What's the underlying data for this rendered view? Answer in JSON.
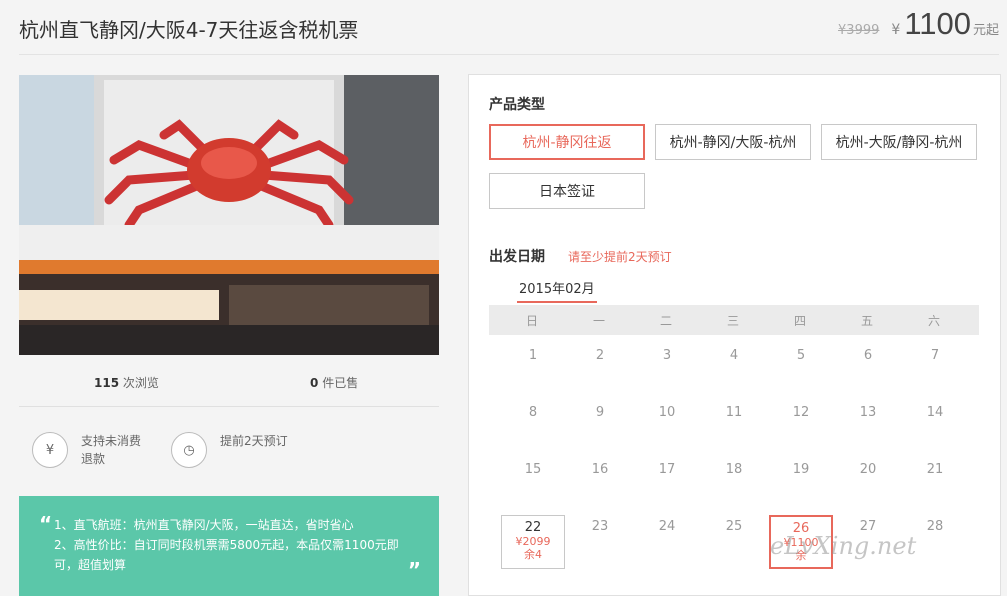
{
  "header": {
    "title": "杭州直飞静冈/大阪4-7天往返含税机票",
    "old_price": "¥3999",
    "currency": "¥",
    "price": "1100",
    "price_suffix": "元起"
  },
  "stats": {
    "views": "115",
    "views_label": "次浏览",
    "sold": "0",
    "sold_label": "件已售"
  },
  "features": [
    {
      "icon": "yen-refund-icon",
      "glyph": "¥",
      "text": "支持未消费退款"
    },
    {
      "icon": "clock-icon",
      "glyph": "◷",
      "text": "提前2天预订"
    }
  ],
  "promo": {
    "line1": "1、直飞航班：杭州直飞静冈/大阪，一站直达，省时省心",
    "line2": "2、高性价比：自订同时段机票需5800元起，本品仅需1100元即",
    "line3": "可，超值划算"
  },
  "product": {
    "heading": "产品类型",
    "types": [
      "杭州-静冈往返",
      "杭州-静冈/大阪-杭州",
      "杭州-大阪/静冈-杭州",
      "日本签证"
    ]
  },
  "departure": {
    "heading": "出发日期",
    "note": "请至少提前2天预订",
    "month": "2015年02月",
    "weekdays": [
      "日",
      "一",
      "二",
      "三",
      "四",
      "五",
      "六"
    ],
    "days": [
      "1",
      "2",
      "3",
      "4",
      "5",
      "6",
      "7",
      "8",
      "9",
      "10",
      "11",
      "12",
      "13",
      "14",
      "15",
      "16",
      "17",
      "18",
      "19",
      "20",
      "21",
      "22",
      "23",
      "24",
      "25",
      "26",
      "27",
      "28"
    ],
    "day22": {
      "date": "22",
      "price": "¥2099",
      "stock": "余4"
    },
    "day26": {
      "date": "26",
      "price": "¥1100",
      "stock": "余"
    }
  },
  "watermark": "eLvXing.net",
  "colors": {
    "accent": "#e8685b",
    "promo_bg": "#5bc7a9"
  }
}
